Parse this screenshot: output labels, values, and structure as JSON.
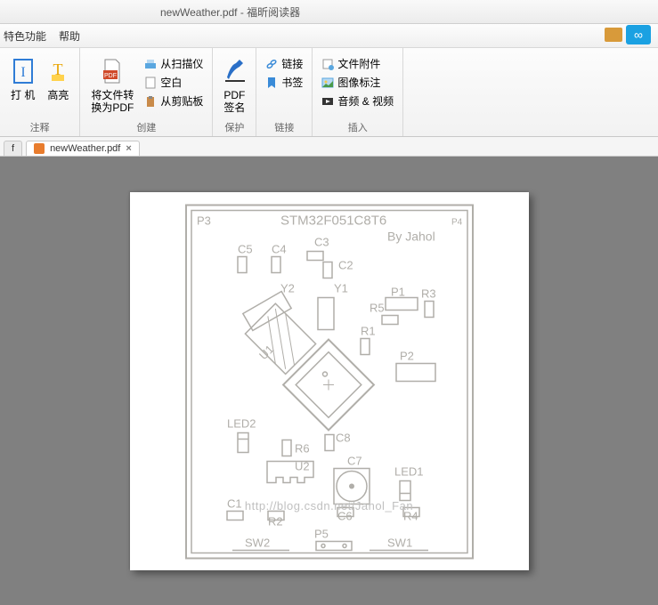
{
  "titlebar": {
    "text": "newWeather.pdf - 福昕阅读器"
  },
  "menubar": {
    "items": [
      "特色功能",
      "帮助"
    ]
  },
  "ribbon": {
    "groups": [
      {
        "label": "注释",
        "big": [
          {
            "name": "typewriter",
            "label": "打\n机"
          },
          {
            "name": "highlight",
            "label": "高亮"
          }
        ]
      },
      {
        "label": "创建",
        "big": [
          {
            "name": "convert-to-pdf",
            "label": "将文件转\n换为PDF"
          }
        ],
        "small": [
          {
            "name": "from-scanner",
            "label": "从扫描仪"
          },
          {
            "name": "blank",
            "label": "空白"
          },
          {
            "name": "from-clipboard",
            "label": "从剪贴板"
          }
        ]
      },
      {
        "label": "保护",
        "big": [
          {
            "name": "pdf-sign",
            "label": "PDF\n签名"
          }
        ]
      },
      {
        "label": "链接",
        "small": [
          {
            "name": "link",
            "label": "链接"
          },
          {
            "name": "bookmark",
            "label": "书签"
          }
        ]
      },
      {
        "label": "插入",
        "small": [
          {
            "name": "file-attachment",
            "label": "文件附件"
          },
          {
            "name": "image-annotation",
            "label": "图像标注"
          },
          {
            "name": "audio-video",
            "label": "音频 & 视频"
          }
        ]
      }
    ]
  },
  "tabs": [
    {
      "name": "",
      "label": "f",
      "active": false
    },
    {
      "name": "newWeather.pdf",
      "label": "newWeather.pdf",
      "active": true
    }
  ],
  "watermark": "http://blog.csdn.net/Jahol_Fan",
  "pcb": {
    "title": "STM32F051C8T6",
    "author": "By Jahol",
    "refdes": {
      "P3": "P3",
      "P4": "P4",
      "C1": "C1",
      "C2": "C2",
      "C3": "C3",
      "C4": "C4",
      "C5": "C5",
      "C6": "C6",
      "C7": "C7",
      "C8": "C8",
      "R1": "R1",
      "R2": "R2",
      "R3": "R3",
      "R4": "R4",
      "R5": "R5",
      "R6": "R6",
      "Y1": "Y1",
      "Y2": "Y2",
      "U1": "U1",
      "U2": "U2",
      "P1": "P1",
      "P2": "P2",
      "P5": "P5",
      "LED1": "LED1",
      "LED2": "LED2",
      "SW1": "SW1",
      "SW2": "SW2"
    }
  }
}
